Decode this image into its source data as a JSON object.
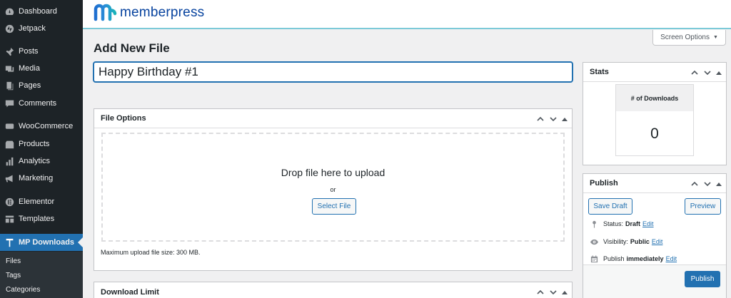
{
  "sidebar": {
    "items": [
      {
        "label": "Dashboard",
        "icon": "dashboard-icon"
      },
      {
        "label": "Jetpack",
        "icon": "jetpack-icon"
      },
      {
        "label": "Posts",
        "icon": "pin-icon"
      },
      {
        "label": "Media",
        "icon": "media-icon"
      },
      {
        "label": "Pages",
        "icon": "pages-icon"
      },
      {
        "label": "Comments",
        "icon": "comments-icon"
      },
      {
        "label": "WooCommerce",
        "icon": "woocommerce-icon"
      },
      {
        "label": "Products",
        "icon": "products-icon"
      },
      {
        "label": "Analytics",
        "icon": "analytics-icon"
      },
      {
        "label": "Marketing",
        "icon": "megaphone-icon"
      },
      {
        "label": "Elementor",
        "icon": "elementor-icon"
      },
      {
        "label": "Templates",
        "icon": "templates-icon"
      },
      {
        "label": "MP Downloads",
        "icon": "mp-downloads-icon"
      }
    ],
    "submenu": [
      "Files",
      "Tags",
      "Categories"
    ]
  },
  "header": {
    "brand": "memberpress"
  },
  "screen_options": "Screen Options",
  "page_title": "Add New File",
  "title_input": {
    "value": "Happy Birthday #1"
  },
  "file_options": {
    "title": "File Options",
    "drop_text": "Drop file here to upload",
    "or_text": "or",
    "select_button": "Select File",
    "max_upload": "Maximum upload file size: 300 MB."
  },
  "download_limit": {
    "title": "Download Limit"
  },
  "stats": {
    "title": "Stats",
    "label": "# of Downloads",
    "value": "0"
  },
  "publish": {
    "title": "Publish",
    "save_draft": "Save Draft",
    "preview": "Preview",
    "status_label": "Status:",
    "status_value": "Draft",
    "visibility_label": "Visibility:",
    "visibility_value": "Public",
    "publish_label": "Publish",
    "publish_value": "immediately",
    "edit": "Edit",
    "publish_button": "Publish"
  },
  "colors": {
    "sidebar_bg": "#1d2327",
    "accent": "#2271b1",
    "brand": "#06429e"
  }
}
